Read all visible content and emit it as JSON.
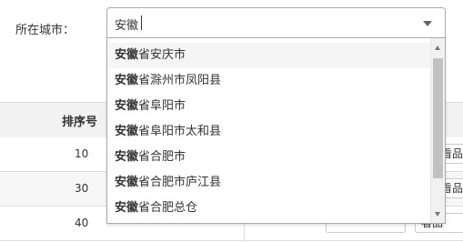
{
  "form": {
    "city_label": "所在城市：",
    "city_select": {
      "value": "安徽"
    }
  },
  "dropdown": {
    "query": "安徽",
    "options": [
      {
        "rest": "省安庆市"
      },
      {
        "rest": "省滁州市凤阳县"
      },
      {
        "rest": "省阜阳市"
      },
      {
        "rest": "省阜阳市太和县"
      },
      {
        "rest": "省合肥市"
      },
      {
        "rest": "省合肥市庐江县"
      },
      {
        "rest": "省合肥总仓"
      }
    ]
  },
  "table": {
    "header_sort": "排序号",
    "rows": [
      {
        "sort": "10",
        "view_label": "看品"
      },
      {
        "sort": "30",
        "view_label": "看品"
      },
      {
        "sort": "40",
        "view_label": "看品"
      }
    ]
  }
}
